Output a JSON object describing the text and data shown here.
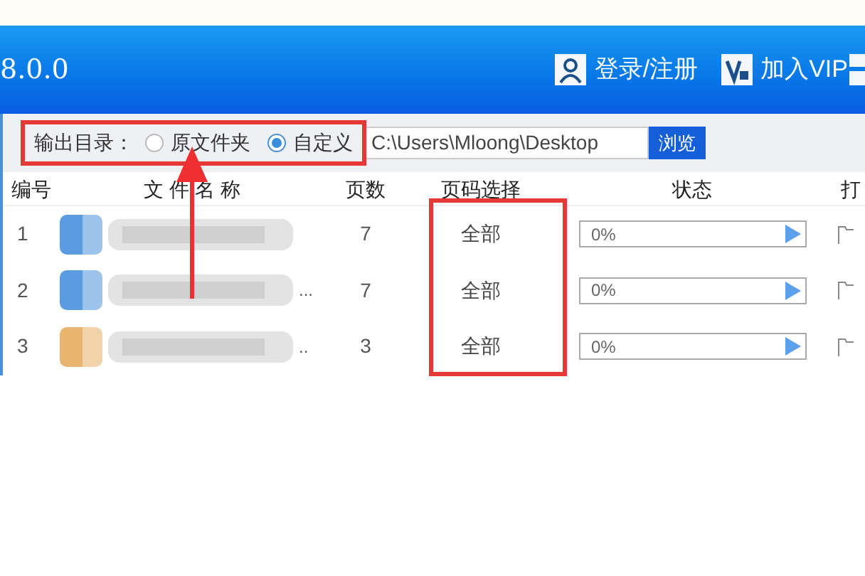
{
  "header": {
    "version": "8.0.0",
    "login": "登录/注册",
    "vip": "加入VIP"
  },
  "output_bar": {
    "label": "输出目录：",
    "options": [
      {
        "label": "原文件夹",
        "selected": false
      },
      {
        "label": "自定义",
        "selected": true
      }
    ],
    "path": "C:\\Users\\Mloong\\Desktop",
    "browse": "浏览"
  },
  "table": {
    "columns": [
      "编号",
      "文件名称",
      "页数",
      "页码选择",
      "状态",
      "打"
    ],
    "rows": [
      {
        "index": "1",
        "color": "#5b9be0",
        "name_suffix": "",
        "pages": "7",
        "range": "全部",
        "progress": "0%",
        "level": 0
      },
      {
        "index": "2",
        "color": "#5b9be0",
        "name_suffix": "...",
        "pages": "7",
        "range": "全部",
        "progress": "0%",
        "level": 0
      },
      {
        "index": "3",
        "color": "#e8b570",
        "name_suffix": "..",
        "pages": "3",
        "range": "全部",
        "progress": "0%",
        "level": 0
      }
    ]
  },
  "annotations": [
    {
      "kind": "box"
    },
    {
      "kind": "box"
    },
    {
      "kind": "arrow"
    }
  ]
}
